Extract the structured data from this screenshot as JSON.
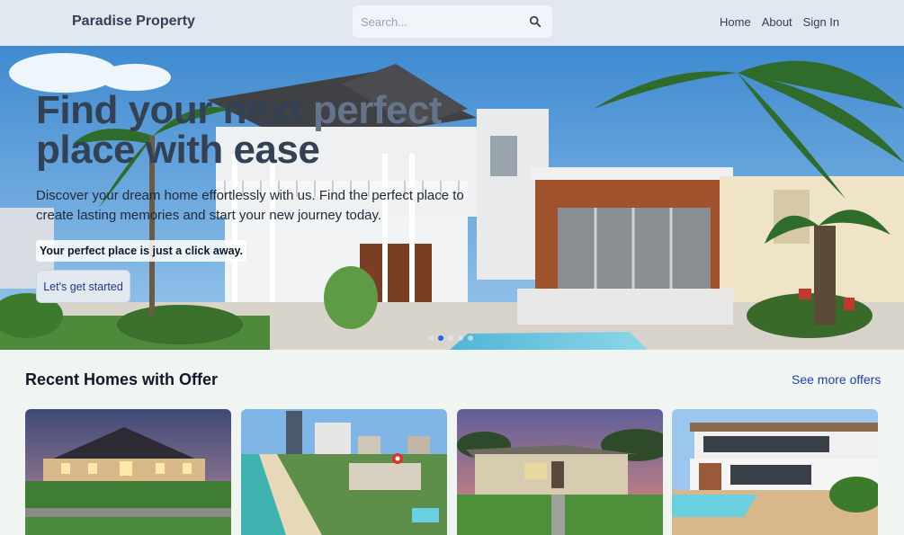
{
  "header": {
    "logo": "Paradise Property",
    "search_placeholder": "Search...",
    "nav": [
      "Home",
      "About",
      "Sign In"
    ]
  },
  "hero": {
    "title_part1": "Find your next ",
    "title_highlight": "perfect",
    "title_part2": "place with ease",
    "subtitle": "Discover your dream home effortlessly with us. Find the perfect place to create lasting memories and start your new journey today.",
    "tagline": "Your perfect place is just a click away.",
    "cta_label": "Let's get started",
    "slides_count": 5,
    "active_slide": 1
  },
  "offers": {
    "title": "Recent Homes with Offer",
    "see_more": "See more offers",
    "cards": [
      {
        "alt": "mansion at dusk"
      },
      {
        "alt": "beachfront towers"
      },
      {
        "alt": "single-storey house at sunset"
      },
      {
        "alt": "modern villa with pool"
      }
    ]
  },
  "colors": {
    "header_bg": "#e2e8f0",
    "page_bg": "#f1f5f1",
    "accent": "#2563eb",
    "link": "#1e40af"
  }
}
